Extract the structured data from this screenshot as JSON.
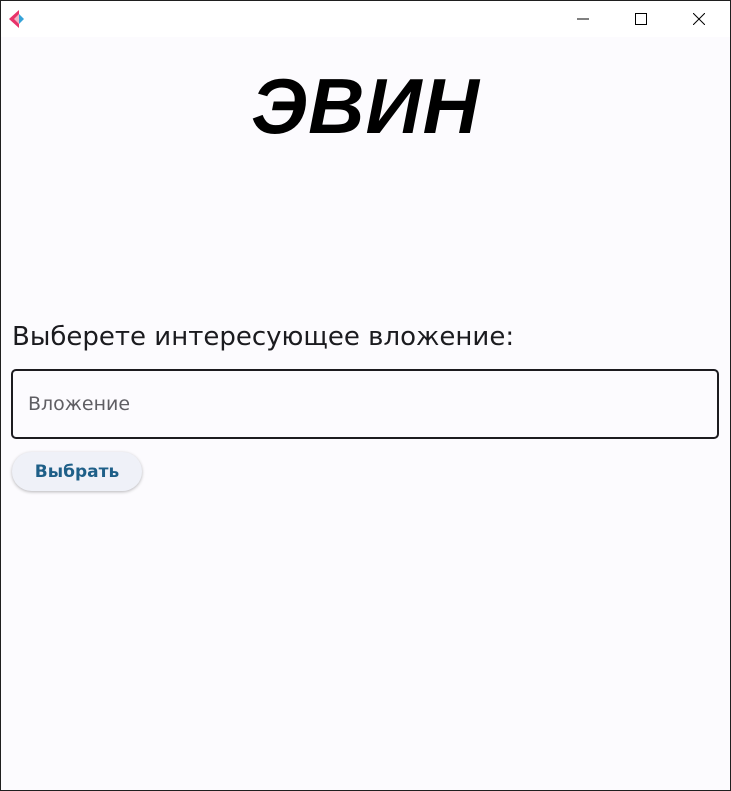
{
  "app": {
    "title": "ЭВИН",
    "prompt": "Выберете интересующее вложение:"
  },
  "attachment_field": {
    "value": "",
    "placeholder": "Вложение"
  },
  "select_button": {
    "label": "Выбрать"
  },
  "colors": {
    "background": "#fcfbfe",
    "button_background": "#eff1f8",
    "button_text": "#1e5f88",
    "field_border": "#1c1b1f"
  },
  "icons": {
    "app_icon": "flutter-style-app-icon",
    "minimize": "minimize-icon",
    "maximize": "maximize-icon",
    "close": "close-icon"
  }
}
